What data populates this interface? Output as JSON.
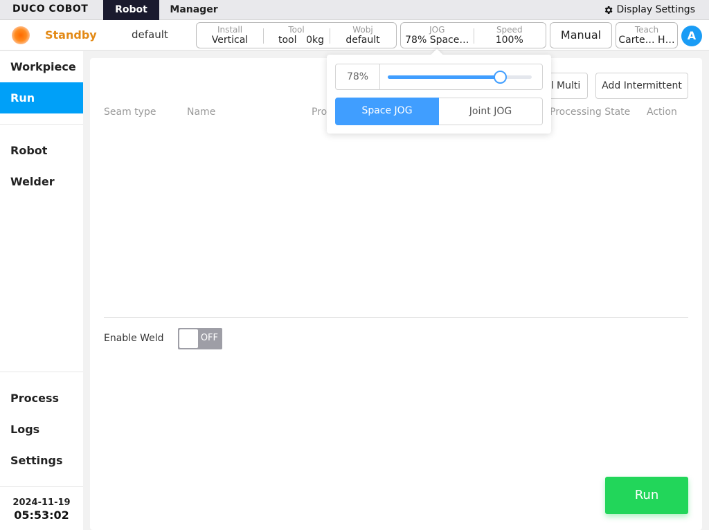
{
  "brand": {
    "logo": "DUCO COBOT"
  },
  "top_tabs": [
    "Robot",
    "Manager"
  ],
  "display_settings": {
    "label": "Display Settings",
    "icon": "gear-icon"
  },
  "status": {
    "state": "Standby",
    "state_color": "#e38a16",
    "project": "default",
    "install": {
      "label": "Install",
      "value": "Vertical"
    },
    "tool": {
      "label": "Tool",
      "name": "tool",
      "weight": "0kg"
    },
    "wobj": {
      "label": "Wobj",
      "value": "default"
    },
    "jog": {
      "label": "JOG",
      "value": "78%  Space…"
    },
    "speed": {
      "label": "Speed",
      "value": "100%"
    },
    "mode": "Manual",
    "teach": {
      "label": "Teach",
      "value": "Carte… H…"
    },
    "user_initial": "A"
  },
  "sidebar": {
    "items": [
      "Workpiece",
      "Run",
      "Robot",
      "Welder",
      "Process",
      "Logs",
      "Settings"
    ],
    "active": "Run",
    "date": "2024-11-19",
    "time": "05:53:02"
  },
  "main": {
    "buttons": {
      "multi": "l Multi",
      "intermittent": "Add Intermittent"
    },
    "columns": [
      "Seam type",
      "Name",
      "Pro",
      "Processing State",
      "Action"
    ],
    "enable_weld_label": "Enable Weld",
    "toggle_state": "OFF",
    "run_label": "Run",
    "run_color": "#22d65a"
  },
  "jog_popover": {
    "speed_percent": 78,
    "speed_display": "78%",
    "modes": [
      "Space JOG",
      "Joint JOG"
    ],
    "active_mode": "Space JOG",
    "accent": "#409eff"
  }
}
